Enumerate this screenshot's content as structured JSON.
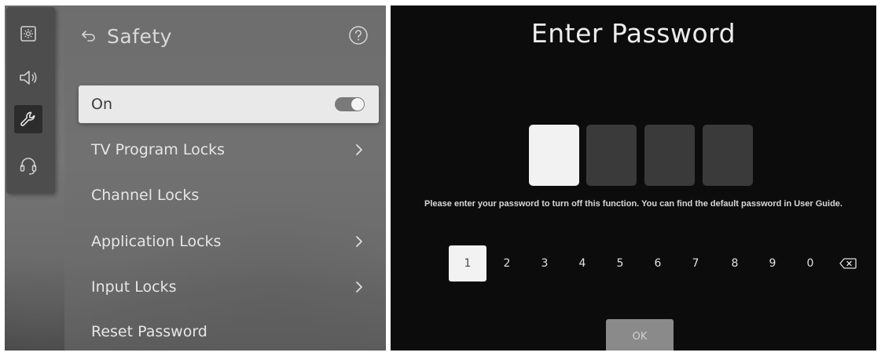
{
  "left_screen": {
    "rail": [
      {
        "name": "picture-icon",
        "selected": false
      },
      {
        "name": "sound-icon",
        "selected": false
      },
      {
        "name": "wrench-icon",
        "selected": true
      },
      {
        "name": "support-headset-icon",
        "selected": false
      }
    ],
    "header": {
      "back_icon": "back-arrow-icon",
      "title": "Safety",
      "help_icon": "help-icon"
    },
    "menu": [
      {
        "label": "On",
        "control": "toggle",
        "toggle_on": true,
        "focused": true
      },
      {
        "label": "TV Program Locks",
        "control": "chevron"
      },
      {
        "label": "Channel Locks",
        "control": "none"
      },
      {
        "label": "Application Locks",
        "control": "chevron"
      },
      {
        "label": "Input Locks",
        "control": "chevron"
      },
      {
        "label": "Reset Password",
        "control": "none"
      }
    ]
  },
  "right_screen": {
    "title": "Enter Password",
    "pin_slots": 4,
    "active_slot": 0,
    "instructions": "Please enter your password to turn off this function. You can find the default password in User Guide.",
    "keypad": [
      "1",
      "2",
      "3",
      "4",
      "5",
      "6",
      "7",
      "8",
      "9",
      "0"
    ],
    "focused_key": "1",
    "backspace_icon": "backspace-icon",
    "ok_label": "OK"
  },
  "colors": {
    "left_background": "#737373",
    "focused_item": "#e9e9e9",
    "right_background": "#0c0c0c",
    "pin_inactive": "#3a3a3a",
    "pin_active": "#f2f2f2",
    "ok_button": "#8a8a8a"
  }
}
